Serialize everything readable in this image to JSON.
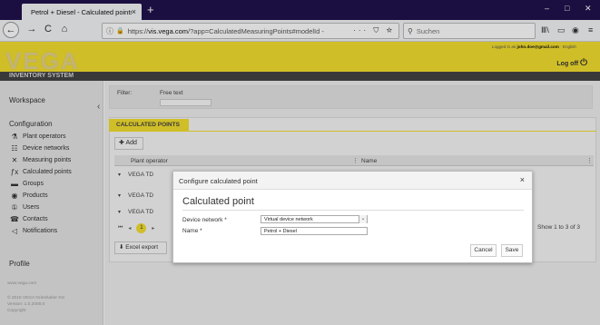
{
  "browser": {
    "tab_title": "Petrol + Diesel - Calculated points",
    "tab_close": "×",
    "new_tab": "+",
    "window_controls": [
      "–",
      "□",
      "✕"
    ],
    "nav_icons": [
      "←",
      "→",
      "C",
      "⌂"
    ],
    "url_info_icon": "ⓘ",
    "url_lock_icon": "🔒",
    "url_host": "vis.vega.com",
    "url_prefix": "https://",
    "url_rest": "/?app=CalculatedMeasuringPoints#modelId -",
    "url_tools": "··· ⛉ ☆",
    "search_icon": "⚲",
    "search_placeholder": "Suchen",
    "toolbar_icons": [
      "Ⅲ\\",
      "▭",
      "◉",
      "≡"
    ]
  },
  "header": {
    "logo_text": "VEGA",
    "system_name": "INVENTORY SYSTEM",
    "logged_in_prefix": "Logged in as",
    "user_email": "john.doe@gmail.com",
    "language": "English",
    "logoff": "Log off",
    "logoff_icon": "⏻",
    "accent_color": "#f5e030"
  },
  "sidebar": {
    "workspace": "Workspace",
    "configuration": "Configuration",
    "items": [
      {
        "icon": "⚗",
        "label": "Plant operators"
      },
      {
        "icon": "☷",
        "label": "Device networks"
      },
      {
        "icon": "✕",
        "label": "Measuring points"
      },
      {
        "icon": "ƒx",
        "label": "Calculated points"
      },
      {
        "icon": "▬",
        "label": "Groups"
      },
      {
        "icon": "◉",
        "label": "Products"
      },
      {
        "icon": "①",
        "label": "Users"
      },
      {
        "icon": "☎",
        "label": "Contacts"
      },
      {
        "icon": "◁",
        "label": "Notifications"
      }
    ],
    "profile": "Profile",
    "collapse_icon": "‹",
    "footer": [
      "www.vega.com",
      "© 2018 VEGA Grieshaber KG",
      "Version: 1.0.2000.0",
      "Copyright"
    ]
  },
  "filter": {
    "label": "Filter:",
    "free_text_label": "Free text",
    "value": ""
  },
  "panel": {
    "tab_label": "CALCULATED POINTS",
    "add_label": "Add",
    "add_icon": "✚",
    "columns": [
      "Plant operator",
      "Name"
    ],
    "rows": [
      "VEGA TD",
      "VEGA TD",
      "VEGA TD"
    ],
    "pager": {
      "first": "⏮",
      "prev": "◂",
      "current": "1",
      "next": "▸"
    },
    "showing": "Show 1 to 3 of 3",
    "excel_label": "Excel export",
    "excel_icon": "⬇"
  },
  "dialog": {
    "title": "Configure calculated point",
    "close": "×",
    "heading": "Calculated point",
    "device_network_label": "Device network *",
    "device_network_value": "Virtual device network",
    "name_label": "Name *",
    "name_value": "Petrol + Diesel",
    "cancel": "Cancel",
    "save": "Save"
  }
}
